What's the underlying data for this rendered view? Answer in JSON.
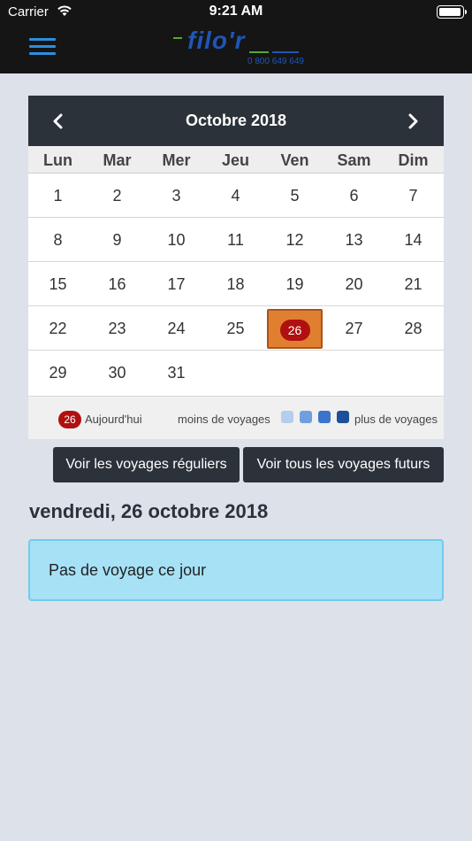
{
  "status_bar": {
    "carrier": "Carrier",
    "time": "9:21 AM"
  },
  "header": {
    "logo_text": "filo'r",
    "logo_phone": "0 800 649 649",
    "menu_icon": "hamburger-menu-icon",
    "colors": {
      "background": "#151515",
      "menu": "#2d8ee0",
      "logo": "#1e56b8",
      "logo_accent": "#56a832"
    }
  },
  "calendar": {
    "month_label": "Octobre 2018",
    "prev_icon": "chevron-left-icon",
    "next_icon": "chevron-right-icon",
    "weekdays": [
      "Lun",
      "Mar",
      "Mer",
      "Jeu",
      "Ven",
      "Sam",
      "Dim"
    ],
    "weeks": [
      [
        "1",
        "2",
        "3",
        "4",
        "5",
        "6",
        "7"
      ],
      [
        "8",
        "9",
        "10",
        "11",
        "12",
        "13",
        "14"
      ],
      [
        "15",
        "16",
        "17",
        "18",
        "19",
        "20",
        "21"
      ],
      [
        "22",
        "23",
        "24",
        "25",
        "26",
        "27",
        "28"
      ],
      [
        "29",
        "30",
        "31",
        "",
        "",
        "",
        ""
      ]
    ],
    "today": "26",
    "selected": "26",
    "colors": {
      "header": "#2b323a",
      "today_pill": "#b01010",
      "selected_cell": "#e07f2f"
    },
    "legend": {
      "today_number": "26",
      "today_label": "Aujourd'hui",
      "less_label": "moins de voyages",
      "more_label": "plus de voyages",
      "scale_colors": [
        "#b5cdee",
        "#6f9fdf",
        "#3a74cc",
        "#1d4f9a"
      ]
    }
  },
  "buttons": {
    "regular": "Voir les voyages réguliers",
    "future": "Voir tous les voyages futurs"
  },
  "selected_day": {
    "heading": "vendredi, 26 octobre 2018",
    "message": "Pas de voyage ce jour"
  }
}
